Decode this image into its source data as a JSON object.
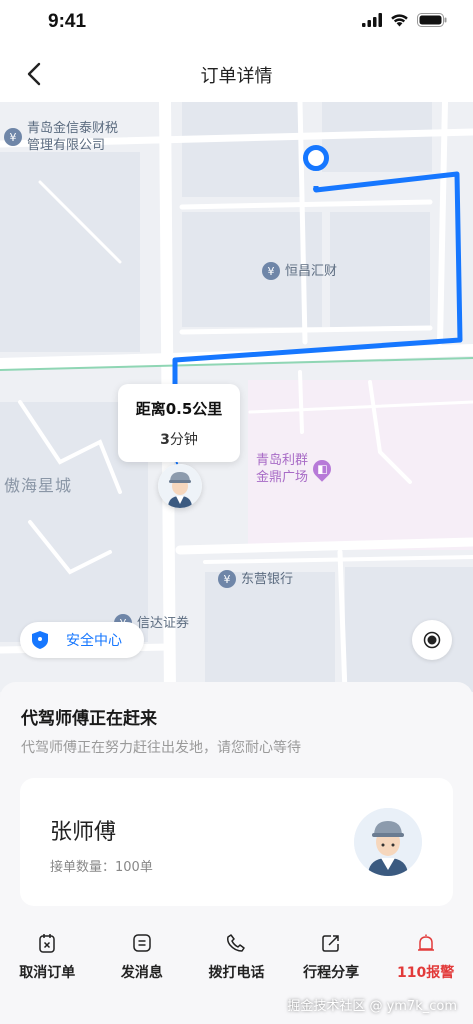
{
  "status_bar": {
    "time": "9:41"
  },
  "nav": {
    "title": "订单详情"
  },
  "map": {
    "pois": [
      {
        "name": "poi-qingdao-jinxintai",
        "lines": [
          "青岛金信泰财税",
          "管理有限公司"
        ]
      },
      {
        "name": "poi-hengchang",
        "lines": [
          "恒昌汇财"
        ]
      },
      {
        "name": "poi-liqun",
        "lines": [
          "青岛利群",
          "金鼎广场"
        ]
      },
      {
        "name": "poi-dongying-bank",
        "lines": [
          "东营银行"
        ]
      },
      {
        "name": "poi-xinda",
        "lines": [
          "信达证券"
        ]
      }
    ],
    "district": "傲海星城",
    "bubble": {
      "distance": "距离0.5公里",
      "time_value": "3",
      "time_unit": "分钟"
    },
    "safety_center": "安全中心",
    "route_color": "#1677ff"
  },
  "panel": {
    "status_title": "代驾师傅正在赶来",
    "status_subtitle": "代驾师傅正在努力赶往出发地，请您耐心等待",
    "driver": {
      "name": "张师傅",
      "orders": "接单数量：100单"
    }
  },
  "actions": [
    {
      "label": "取消订单",
      "icon": "cancel-order-icon"
    },
    {
      "label": "发消息",
      "icon": "message-icon"
    },
    {
      "label": "拨打电话",
      "icon": "phone-icon"
    },
    {
      "label": "行程分享",
      "icon": "share-icon"
    },
    {
      "label": "110报警",
      "icon": "alarm-icon",
      "color": "#e23a3a"
    }
  ],
  "watermark": "掘金技术社区 @ ym7k_com"
}
